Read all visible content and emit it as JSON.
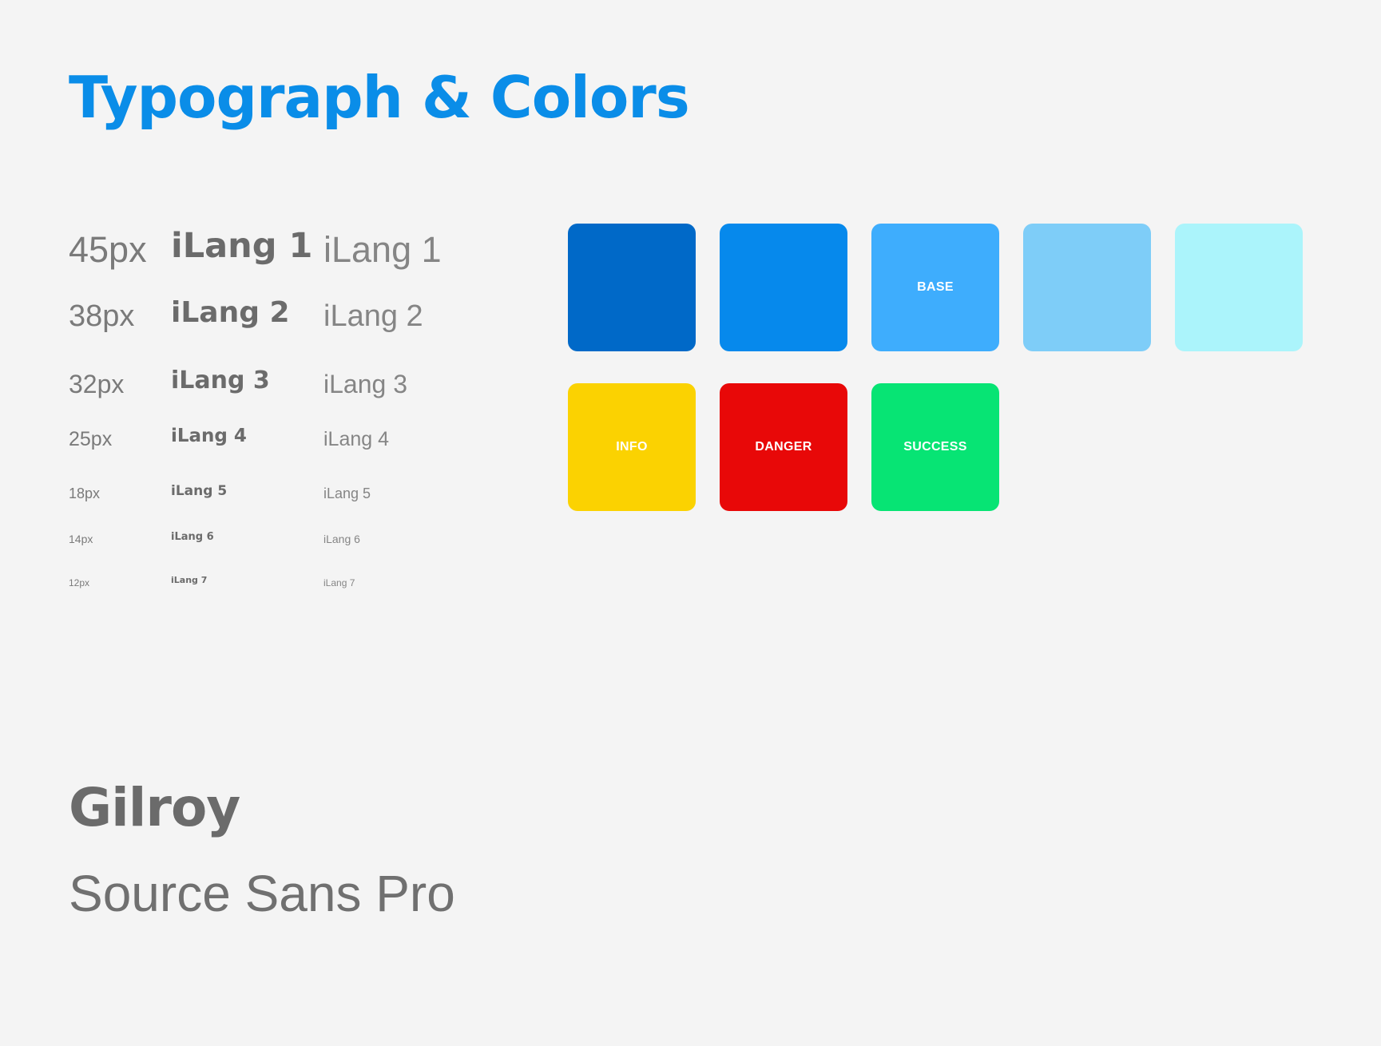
{
  "title": "Typograph & Colors",
  "type_scale": [
    {
      "size_label": "45px",
      "heading": "iLang 1",
      "body": "iLang 1"
    },
    {
      "size_label": "38px",
      "heading": "iLang 2",
      "body": "iLang 2"
    },
    {
      "size_label": "32px",
      "heading": "iLang 3",
      "body": "iLang 3"
    },
    {
      "size_label": "25px",
      "heading": "iLang 4",
      "body": "iLang 4"
    },
    {
      "size_label": "18px",
      "heading": "iLang 5",
      "body": "iLang 5"
    },
    {
      "size_label": "14px",
      "heading": "iLang 6",
      "body": "iLang 6"
    },
    {
      "size_label": "12px",
      "heading": "iLang 7",
      "body": "iLang 7"
    }
  ],
  "palette": {
    "blues": [
      {
        "label": "",
        "color": "#0069c8"
      },
      {
        "label": "",
        "color": "#0689ec"
      },
      {
        "label": "BASE",
        "color": "#3eadfd"
      },
      {
        "label": "",
        "color": "#7ecdf8"
      },
      {
        "label": "",
        "color": "#abf4fb"
      }
    ],
    "status": [
      {
        "label": "INFO",
        "color": "#fbd201"
      },
      {
        "label": "DANGER",
        "color": "#e80808"
      },
      {
        "label": "SUCCESS",
        "color": "#07e474"
      }
    ]
  },
  "fonts": {
    "heading": "Gilroy",
    "body": "Source Sans Pro"
  }
}
